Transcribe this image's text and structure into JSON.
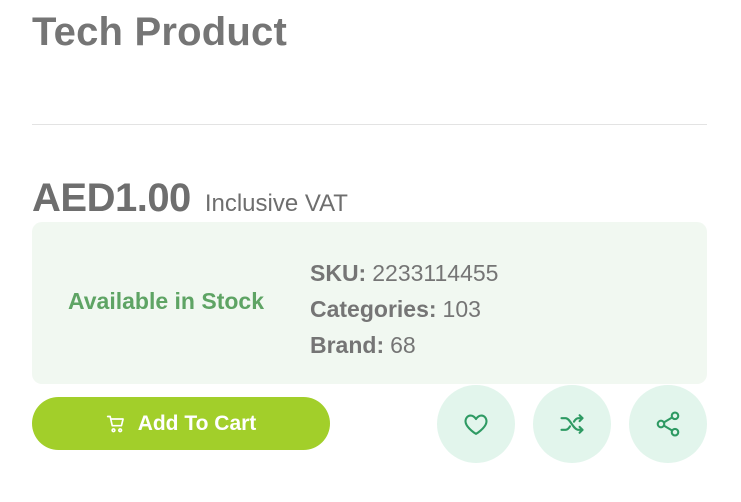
{
  "product": {
    "title": "Tech Product",
    "price": "AED1.00",
    "vat_note": "Inclusive VAT"
  },
  "info": {
    "stock_status": "Available in Stock",
    "sku_label": "SKU:",
    "sku_value": "2233114455",
    "categories_label": "Categories:",
    "categories_value": "103",
    "brand_label": "Brand:",
    "brand_value": "68"
  },
  "actions": {
    "add_to_cart_label": "Add To Cart",
    "cart_icon": "cart-icon",
    "wishlist_icon": "heart-icon",
    "compare_icon": "shuffle-icon",
    "share_icon": "share-icon"
  },
  "colors": {
    "accent": "#a2cf2a",
    "stock_green": "#5ea464",
    "icon_green": "#2e9a63",
    "info_bg": "#f1f8f1",
    "circle_bg": "#e2f5ec"
  }
}
